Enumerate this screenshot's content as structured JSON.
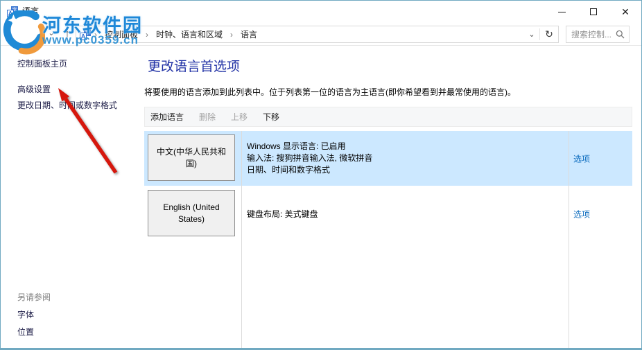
{
  "titlebar": {
    "title": "语言"
  },
  "navbar": {
    "breadcrumb": [
      "控制面板",
      "时钟、语言和区域",
      "语言"
    ],
    "search_placeholder": "搜索控制..."
  },
  "sidebar": {
    "home": "控制面板主页",
    "advanced": "高级设置",
    "change_formats": "更改日期、时间或数字格式",
    "see_also": "另请参阅",
    "fonts": "字体",
    "location": "位置"
  },
  "main": {
    "heading": "更改语言首选项",
    "description": "将要使用的语言添加到此列表中。位于列表第一位的语言为主语言(即你希望看到并最常使用的语言)。",
    "toolbar": {
      "add": "添加语言",
      "remove": "删除",
      "move_up": "上移",
      "move_down": "下移"
    },
    "languages": [
      {
        "name": "中文(中华人民共和国)",
        "details": [
          "Windows 显示语言: 已启用",
          "输入法: 搜狗拼音输入法, 微软拼音",
          "日期、时间和数字格式"
        ],
        "action": "选项",
        "selected": true
      },
      {
        "name": "English (United States)",
        "details": [
          "键盘布局: 美式键盘"
        ],
        "action": "选项",
        "selected": false
      }
    ]
  },
  "watermark": {
    "site_name": "河东软件园",
    "site_url": "www.pc0359.cn"
  },
  "colors": {
    "window_border": "#70a9c1",
    "selection_bg": "#cce8ff",
    "option_link": "#0b6bbe",
    "heading": "#2031a5",
    "arrow_red": "#d6170d",
    "watermark_blue": "#1e88d8",
    "watermark_orange": "#f09a3c"
  }
}
